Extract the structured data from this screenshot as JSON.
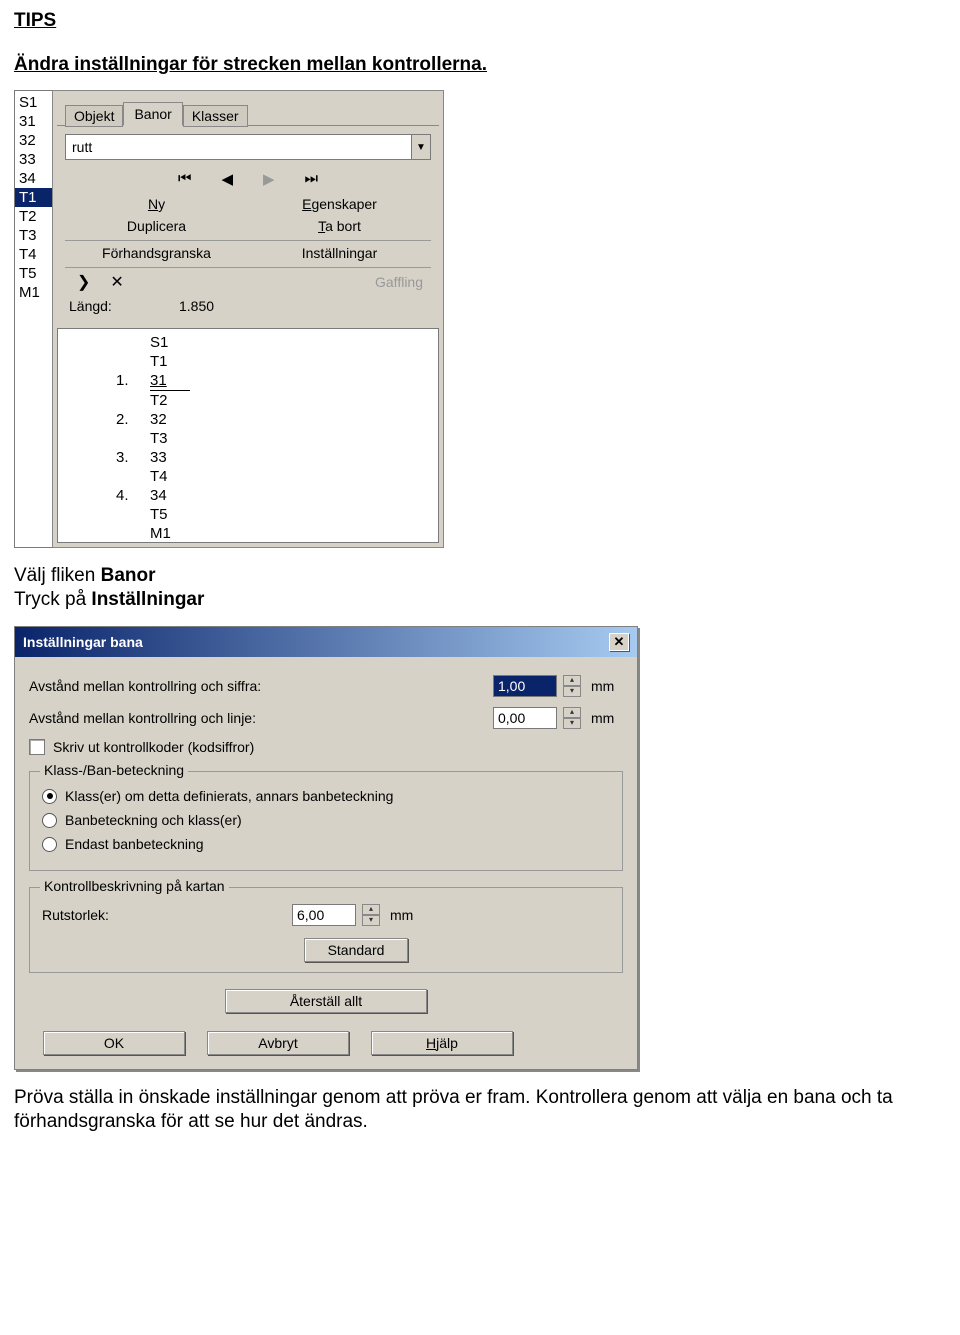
{
  "doc": {
    "tips": "TIPS",
    "subheading": "Ändra inställningar för strecken mellan kontrollerna.",
    "para1_a": "Välj fliken ",
    "para1_b": "Banor",
    "para1_c": "Tryck på ",
    "para1_d": "Inställningar",
    "para2": "Pröva ställa in önskade inställningar genom att pröva er fram. Kontrollera genom att välja en bana och ta förhandsgranska för att se hur det ändras."
  },
  "panel": {
    "sideList": [
      "S1",
      "31",
      "32",
      "33",
      "34",
      "T1",
      "T2",
      "T3",
      "T4",
      "T5",
      "M1"
    ],
    "selectedIndex": 5,
    "tabs": {
      "objekt": "Objekt",
      "banor": "Banor",
      "klasser": "Klasser"
    },
    "dropdownValue": "rutt",
    "btns": {
      "ny": "Ny",
      "egenskaper": "Egenskaper",
      "duplicera": "Duplicera",
      "tabort": "Ta bort",
      "forhandsgranska": "Förhandsgranska",
      "installningar": "Inställningar",
      "gaffling": "Gaffling"
    },
    "lengthLabel": "Längd:",
    "lengthValue": "1.850",
    "seq": {
      "top": "S1",
      "below": "T1",
      "n1": "1.",
      "v1": "31",
      "sep": "T2",
      "n2": "2.",
      "v2": "32",
      "v2b": "T3",
      "n3": "3.",
      "v3": "33",
      "v3b": "T4",
      "n4": "4.",
      "v4": "34",
      "v4b": "T5",
      "v4c": "M1"
    }
  },
  "dialog": {
    "title": "Inställningar bana",
    "row1Label": "Avstånd mellan kontrollring och siffra:",
    "row1Value": "1,00",
    "row2Label": "Avstånd mellan kontrollring och linje:",
    "row2Value": "0,00",
    "unit": "mm",
    "checkboxLabel": "Skriv ut kontrollkoder (kodsiffror)",
    "fieldset1": {
      "legend": "Klass-/Ban-beteckning",
      "opt1": "Klass(er) om detta definierats, annars banbeteckning",
      "opt2": "Banbeteckning och klass(er)",
      "opt3": "Endast banbeteckning"
    },
    "fieldset2": {
      "legend": "Kontrollbeskrivning på kartan",
      "rutLabel": "Rutstorlek:",
      "rutValue": "6,00",
      "standard": "Standard"
    },
    "resetAll": "Återställ allt",
    "ok": "OK",
    "cancel": "Avbryt",
    "help": "Hjälp",
    "helpUnderline": "H"
  }
}
